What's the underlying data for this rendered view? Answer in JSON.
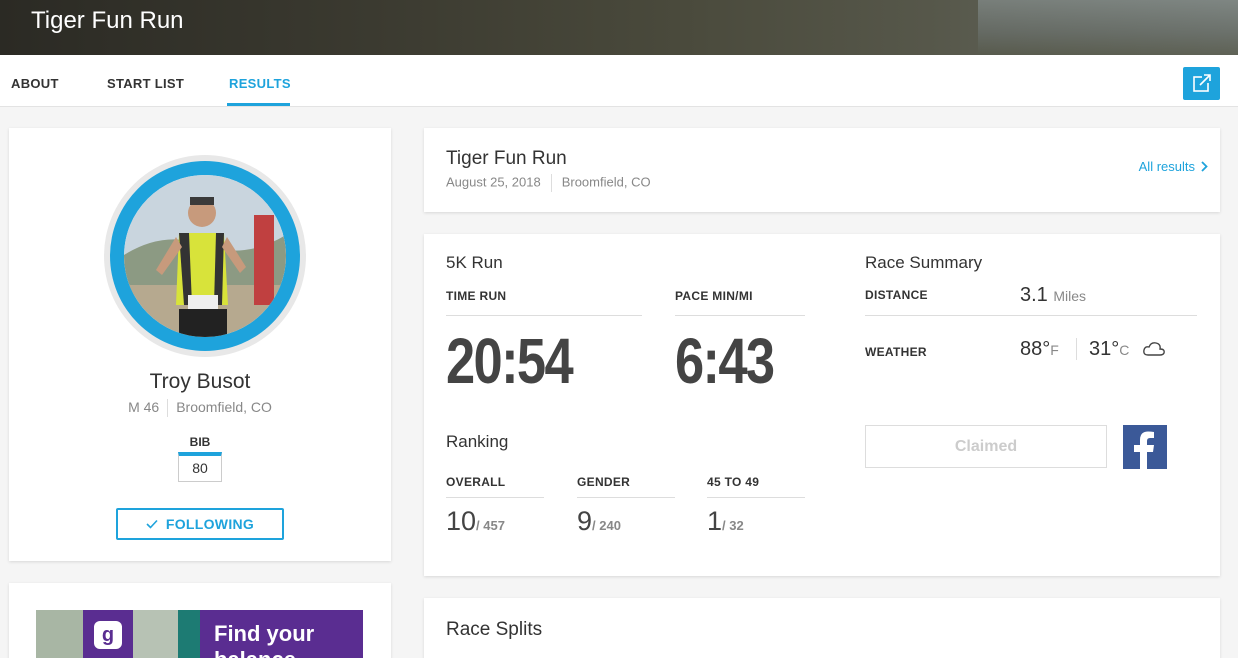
{
  "header": {
    "title": "Tiger Fun Run"
  },
  "tabs": [
    {
      "label": "ABOUT"
    },
    {
      "label": "START LIST"
    },
    {
      "label": "RESULTS"
    }
  ],
  "active_tab": "RESULTS",
  "share": {
    "icon": "share-icon"
  },
  "athlete": {
    "name": "Troy Busot",
    "gender_age": "M 46",
    "location": "Broomfield, CO",
    "bib_label": "BIB",
    "bib": "80",
    "follow_label": "FOLLOWING",
    "follow_icon": "check-icon"
  },
  "ad": {
    "text_line1": "Find your",
    "text_line2": "balance",
    "logo": "g"
  },
  "race": {
    "title": "Tiger Fun Run",
    "date": "August 25, 2018",
    "location": "Broomfield, CO",
    "all_results_label": "All results"
  },
  "result": {
    "event": "5K Run",
    "time_label": "TIME RUN",
    "time": "20:54",
    "pace_label": "PACE MIN/MI",
    "pace": "6:43"
  },
  "ranking": {
    "title": "Ranking",
    "items": [
      {
        "label": "OVERALL",
        "place": "10",
        "total": "/ 457"
      },
      {
        "label": "GENDER",
        "place": "9",
        "total": "/ 240"
      },
      {
        "label": "45 TO 49",
        "place": "1",
        "total": "/ 32"
      }
    ]
  },
  "summary": {
    "title": "Race Summary",
    "distance_label": "DISTANCE",
    "distance_value": "3.1",
    "distance_unit": "Miles",
    "weather_label": "WEATHER",
    "temp_f": "88°",
    "unit_f": "F",
    "temp_c": "31°",
    "unit_c": "C",
    "weather_icon": "cloud-icon",
    "claimed_label": "Claimed",
    "facebook_icon": "facebook-icon"
  },
  "splits": {
    "title": "Race Splits"
  },
  "colors": {
    "accent": "#1ea3dc",
    "facebook": "#3b5998",
    "ad_purple": "#5a2d91"
  }
}
